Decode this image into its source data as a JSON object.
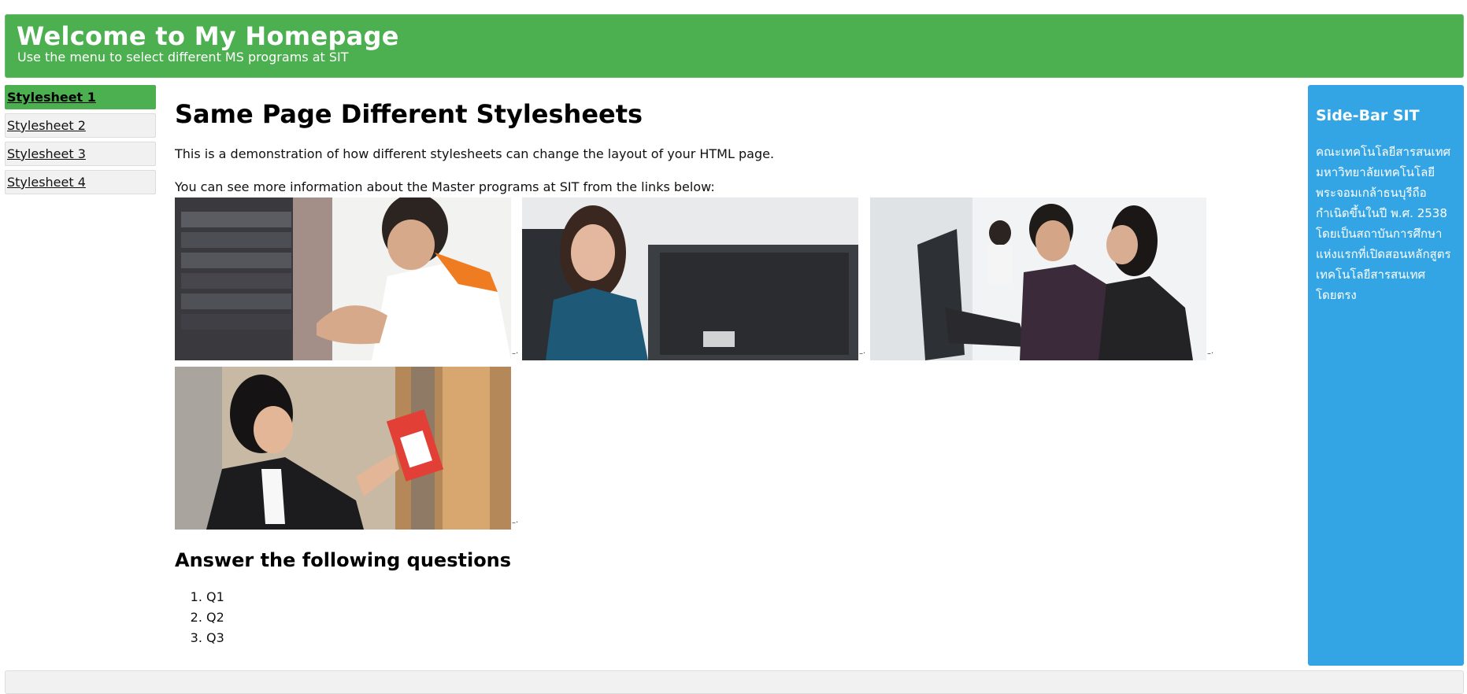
{
  "header": {
    "title": "Welcome to My Homepage",
    "subtitle": "Use the menu to select different MS programs at SIT"
  },
  "menu": {
    "items": [
      {
        "label": "Stylesheet 1",
        "active": true
      },
      {
        "label": "Stylesheet 2",
        "active": false
      },
      {
        "label": "Stylesheet 3",
        "active": false
      },
      {
        "label": "Stylesheet 4",
        "active": false
      }
    ]
  },
  "main": {
    "heading": "Same Page Different Stylesheets",
    "intro": "This is a demonstration of how different stylesheets can change the layout of your HTML page.",
    "links_text": "You can see more information about the Master programs at SIT from the links below:",
    "images": [
      {
        "name": "server-rack-student-photo"
      },
      {
        "name": "student-at-computer-photo"
      },
      {
        "name": "computer-lab-students-photo"
      },
      {
        "name": "student-library-photo"
      }
    ],
    "questions_heading": "Answer the following questions",
    "questions": [
      "Q1",
      "Q2",
      "Q3"
    ]
  },
  "sidebar": {
    "title": "Side-Bar SIT",
    "text": "คณะเทคโนโลยีสารสนเทศ มหาวิทยาลัยเทคโนโลยีพระจอมเกล้าธนบุรีถือกำเนิดขึ้นในปี พ.ศ. 2538 โดยเป็นสถาบันการศึกษาแห่งแรกที่เปิดสอนหลักสูตรเทคโนโลยีสารสนเทศโดยตรง"
  },
  "colors": {
    "header_bg": "#4caf50",
    "sidebar_bg": "#33a5e5",
    "menu_bg": "#f1f1f1",
    "menu_active_bg": "#4caf50"
  }
}
